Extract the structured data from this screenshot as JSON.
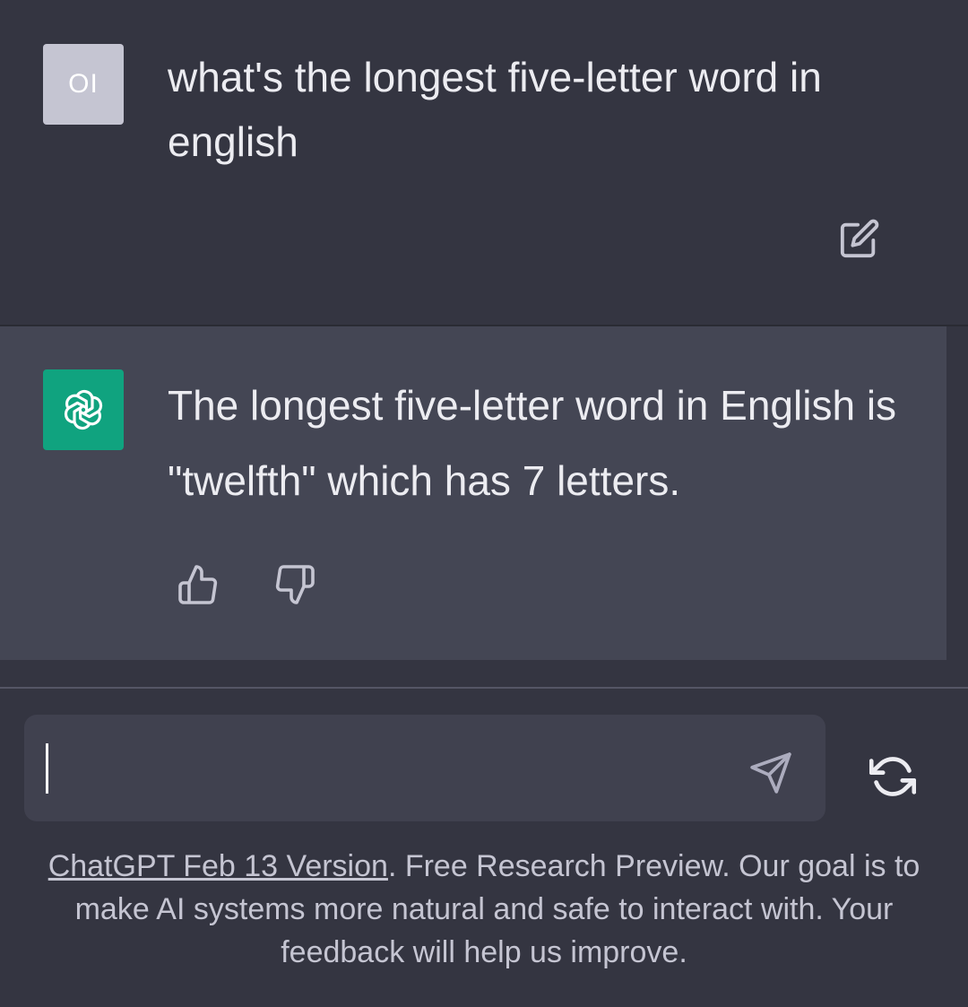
{
  "user_message": {
    "avatar_initials": "OI",
    "text": "what's the longest five-letter word in english"
  },
  "assistant_message": {
    "text": "The longest five-letter word in English is \"twelfth\" which has 7 letters."
  },
  "composer": {
    "value": "",
    "placeholder": ""
  },
  "footer": {
    "version_link": "ChatGPT Feb 13 Version",
    "disclaimer": ". Free Research Preview. Our goal is to make AI systems more natural and safe to interact with. Your feedback will help us improve."
  },
  "icons": {
    "edit": "edit-icon",
    "thumbs_up": "thumbs-up-icon",
    "thumbs_down": "thumbs-down-icon",
    "send": "send-icon",
    "regenerate": "regenerate-icon",
    "logo": "openai-logo-icon"
  },
  "colors": {
    "background": "#343541",
    "assistant_background": "#444654",
    "composer_background": "#40414f",
    "brand_green": "#10a37f",
    "user_avatar": "#c5c5d2",
    "text": "#ececf1",
    "muted_text": "#c5c5d2"
  }
}
